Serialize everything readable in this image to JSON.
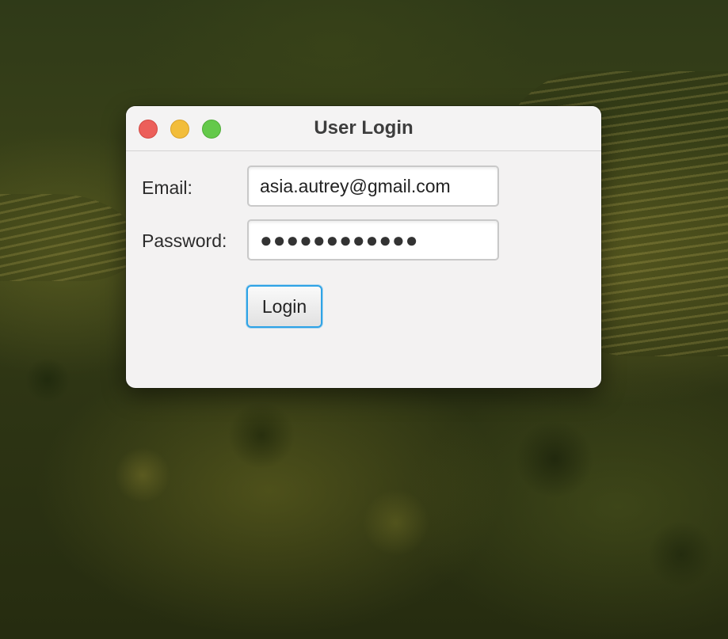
{
  "window": {
    "title": "User Login",
    "controls": {
      "close_color": "#ec5f5a",
      "minimize_color": "#f2bd3b",
      "maximize_color": "#64c94a"
    }
  },
  "form": {
    "email_label": "Email:",
    "email_value": "asia.autrey@gmail.com",
    "password_label": "Password:",
    "password_value": "●●●●●●●●●●●●",
    "login_label": "Login"
  },
  "colors": {
    "window_bg": "#f3f2f2",
    "focus_ring": "#2ea3e6"
  }
}
